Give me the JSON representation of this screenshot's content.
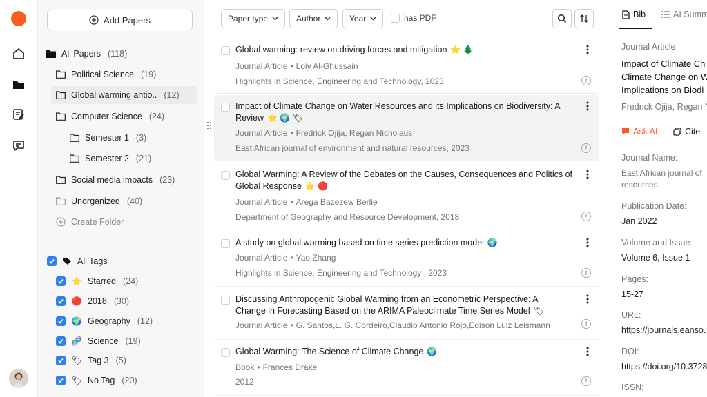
{
  "rail": {
    "icons": [
      "home-icon",
      "folder-icon",
      "edit-note-icon",
      "chat-icon"
    ]
  },
  "sidebar": {
    "add_button": "Add Papers",
    "all_papers": {
      "label": "All Papers",
      "count": "(118)"
    },
    "folders": [
      {
        "label": "Political Science",
        "count": "(19)"
      },
      {
        "label": "Global warming antio..",
        "count": "(12)"
      },
      {
        "label": "Computer Science",
        "count": "(24)"
      },
      {
        "label": "Semester 1",
        "count": "(3)"
      },
      {
        "label": "Semester 2",
        "count": "(21)"
      },
      {
        "label": "Social media impacts",
        "count": "(23)"
      },
      {
        "label": "Unorganized",
        "count": "(40)"
      }
    ],
    "create_folder": "Create Folder",
    "all_tags": "All Tags",
    "tags": [
      {
        "label": "Starred",
        "count": "(24)",
        "emoji": "⭐"
      },
      {
        "label": "2018",
        "count": "(30)",
        "emoji": "🔴"
      },
      {
        "label": "Geography",
        "count": "(12)",
        "emoji": "🌍"
      },
      {
        "label": "Science",
        "count": "(19)",
        "emoji": "🧬"
      },
      {
        "label": "Tag 3",
        "count": "(5)",
        "emoji": "🏷"
      },
      {
        "label": "No Tag",
        "count": "(20)",
        "emoji": "🏷"
      }
    ]
  },
  "filters": {
    "paper_type": "Paper type",
    "author": "Author",
    "year": "Year",
    "has_pdf": "has PDF"
  },
  "papers": [
    {
      "title": "Global warming: review on driving forces and mitigation",
      "icons": "⭐ 🌲",
      "type": "Journal Article",
      "authors": "Loiy Al-Ghussain",
      "source": "Highlights in Science, Engineering and Technology, 2023"
    },
    {
      "title": "Impact of Climate Change on Water Resources and its Implications on Biodiversity: A Review",
      "icons": "⭐ 🌍 🏷",
      "type": "Journal Article",
      "authors": "Fredrick Ojija, Regan Nicholaus",
      "source": "East African journal of environment and natural resources, 2023"
    },
    {
      "title": "Global Warming: A Review of the Debates on the Causes, Consequences and Politics of Global Response",
      "icons": "⭐ 🔴",
      "type": "Journal Article",
      "authors": "Arega Bazezew Berlie",
      "source": "Department of Geography and Resource Development, 2018"
    },
    {
      "title": "A study on global warming based on time series prediction model",
      "icons": "🌍",
      "type": "Journal Article",
      "authors": "Yao Zhang",
      "source": "Highlights in Science, Engineering and Technology , 2023"
    },
    {
      "title": "Discussing Anthropogenic Global Warming from an Econometric Perspective: A Change in Forecasting Based on the ARIMA Paleoclimate Time Series Model",
      "icons": "🏷",
      "type": "Journal Article",
      "authors": "G. Santos,L. G. Cordeiro,Claudio Antonio Rojo,Edison Luiz Leismann",
      "source": ""
    },
    {
      "title": "Global Warming: The Science of Climate Change",
      "icons": "🌍",
      "type": "Book",
      "authors": "Frances Drake",
      "source": "2012"
    }
  ],
  "detail": {
    "tab_bib": "Bib",
    "tab_ai": "AI Summ",
    "type": "Journal Article",
    "title_lines": [
      "Impact of Climate Ch",
      "Climate Change on W",
      "Implications on Biodi"
    ],
    "authors": "Fredrick Ojija, Regan N",
    "ask_ai": "Ask AI",
    "cite": "Cite",
    "journal_label": "Journal Name:",
    "journal_lines": [
      "East African journal of",
      "resources"
    ],
    "pubdate_label": "Publication Date:",
    "pubdate": "Jan 2022",
    "volume_label": "Volume and Issue:",
    "volume": "Volume 6, Issue 1",
    "pages_label": "Pages:",
    "pages": "15-27",
    "url_label": "URL:",
    "url": "https://journals.eanso.",
    "doi_label": "DOI:",
    "doi": "https://doi.org/10.3728",
    "issn_label": "ISSN:",
    "accent": "#ff5a1f"
  }
}
